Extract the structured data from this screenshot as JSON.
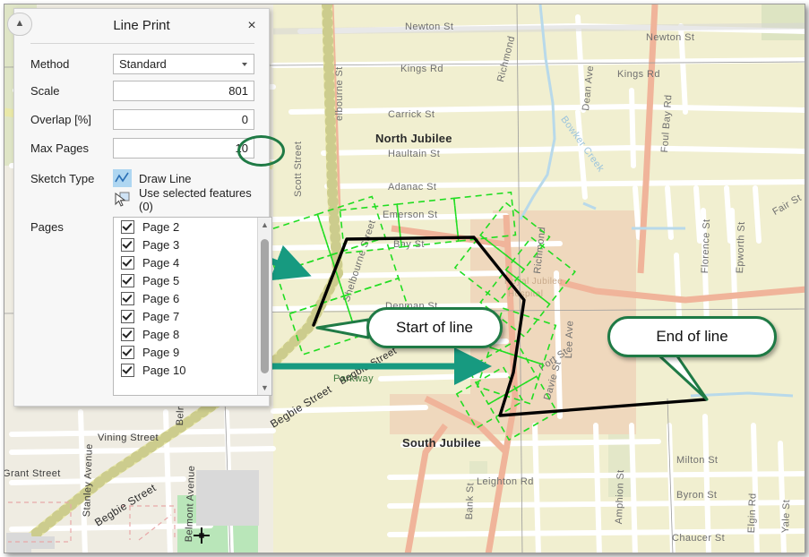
{
  "dialog": {
    "title": "Line Print",
    "close_label": "×",
    "collapse_icon": "chevron-up-icon",
    "rows": {
      "method": {
        "label": "Method",
        "value": "Standard"
      },
      "scale": {
        "label": "Scale",
        "value": "801"
      },
      "overlap": {
        "label": "Overlap [%]",
        "value": "0"
      },
      "maxpages": {
        "label": "Max Pages",
        "value": "10"
      }
    },
    "sketch": {
      "label": "Sketch Type",
      "options": [
        {
          "label": "Draw Line",
          "icon": "draw-line-icon",
          "selected": true
        },
        {
          "label": "Use selected features (0)",
          "icon": "select-features-icon",
          "selected": false
        }
      ]
    },
    "pages": {
      "label": "Pages",
      "items": [
        {
          "label": "Page 2",
          "checked": true
        },
        {
          "label": "Page 3",
          "checked": true
        },
        {
          "label": "Page 4",
          "checked": true
        },
        {
          "label": "Page 5",
          "checked": true
        },
        {
          "label": "Page 6",
          "checked": true
        },
        {
          "label": "Page 7",
          "checked": true
        },
        {
          "label": "Page 8",
          "checked": true
        },
        {
          "label": "Page 9",
          "checked": true
        },
        {
          "label": "Page 10",
          "checked": true
        }
      ],
      "scroll_up_icon": "chevron-up-icon",
      "scroll_down_icon": "chevron-down-icon"
    }
  },
  "annotations": {
    "accent_color": "#1f7a45",
    "arrow_color": "#179a80",
    "callouts": [
      {
        "id": "start",
        "text": "Start of line"
      },
      {
        "id": "end",
        "text": "End of line"
      }
    ],
    "circle_target": "10"
  },
  "map": {
    "page_outline_color": "#22dd22",
    "sketch_color": "#000000",
    "areas": [
      {
        "label": "North Jubilee",
        "style": "dark"
      },
      {
        "label": "South Jubilee",
        "style": "dark"
      },
      {
        "label": "Royal Jubilee",
        "style": "tan"
      },
      {
        "label": "Hospital",
        "style": "tan"
      }
    ],
    "streets": [
      "Newton St",
      "Kings Rd",
      "Carrick St",
      "Haultain St",
      "Adanac St",
      "Emerson St",
      "Bay St",
      "Denman St",
      "Fort St",
      "Leighton Rd",
      "Milton St",
      "Byron St",
      "Chaucer St",
      "Vining Street",
      "Grant Street",
      "Begbie Street",
      "Haultain Street",
      "Scott Street",
      "Shelbourne Street",
      "elbourne St",
      "Richmond",
      "Dean Ave",
      "Foul Bay Rd",
      "Bowker Creek",
      "Florence St",
      "Epworth St",
      "Fair St",
      "Lee Ave",
      "Davie St",
      "Bank St",
      "Amphion St",
      "Elgin Rd",
      "Yale St",
      "Stanley Avenue",
      "Belmont Avenue",
      "Parkway"
    ]
  }
}
